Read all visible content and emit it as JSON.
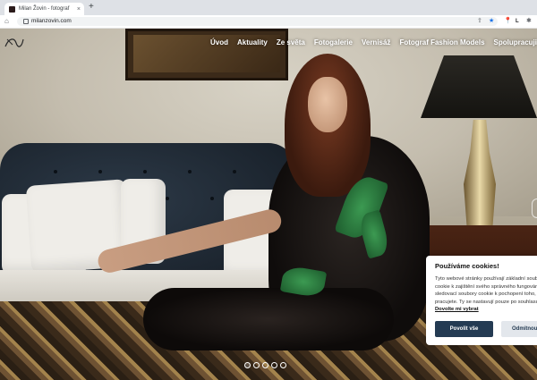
{
  "browser": {
    "tab_title": "Milan Žovin - fotograf",
    "tab_close": "×",
    "new_tab": "+",
    "url": "milanzovin.com",
    "back_icon": "arrow-left-icon",
    "reload_icon": "reload-icon",
    "profile_letter": "L"
  },
  "site": {
    "nav": [
      {
        "label": "Úvod"
      },
      {
        "label": "Aktuality"
      },
      {
        "label": "Ze světa"
      },
      {
        "label": "Fotogalerie"
      },
      {
        "label": "Vernisáž"
      },
      {
        "label": "Fotograf Fashion Models"
      },
      {
        "label": "Spolupracuji"
      }
    ],
    "slider_dots": 5,
    "active_dot": 1
  },
  "cookie": {
    "title": "Používáme cookies!",
    "text": "Tyto webové stránky používají základní soubory cookie k zajištění svého správného fungování a sledovací soubory cookie k pochopení toho, jak s nimi pracujete. Ty se nastavují pouze po souhlasu.",
    "link": "Dovolte mi vybrat",
    "accept": "Povolit vše",
    "reject": "Odmítnout vše"
  },
  "colors": {
    "accept_button": "#243b53",
    "reject_button": "#e3e7ec",
    "nav_text": "#ffffff"
  }
}
